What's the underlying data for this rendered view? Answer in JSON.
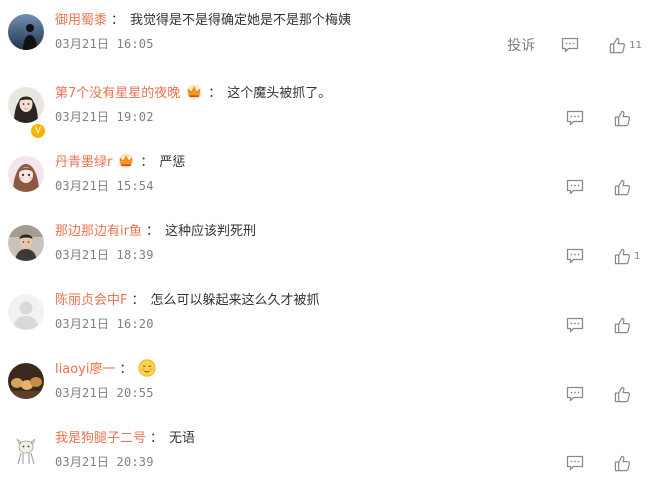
{
  "report_label": "投诉",
  "comments": [
    {
      "user": "御用蜀黍",
      "sep": "：",
      "text": "我觉得是不是得确定她是不是那个梅姨",
      "time": "03月21日 16:05",
      "likes": "11",
      "avatar_icon": "avatar-dark-silhouette",
      "vip_badge": false,
      "crown": false
    },
    {
      "user": "第7个没有星星的夜晚",
      "sep": "：",
      "text": "这个魔头被抓了。",
      "time": "03月21日 19:02",
      "likes": "",
      "avatar_icon": "avatar-girl-portrait",
      "vip_badge": true,
      "crown": true
    },
    {
      "user": "丹青墨绿r",
      "sep": "：",
      "text": "严惩",
      "time": "03月21日 15:54",
      "likes": "",
      "avatar_icon": "avatar-girl-cartoon",
      "vip_badge": false,
      "crown": true
    },
    {
      "user": "那边那边有ir鱼",
      "sep": "：",
      "text": "这种应该判死刑",
      "time": "03月21日 18:39",
      "likes": "1",
      "avatar_icon": "avatar-boy-photo",
      "vip_badge": false,
      "crown": false
    },
    {
      "user": "陈丽贞会中F",
      "sep": "：",
      "text": "怎么可以躲起来这么久才被抓",
      "time": "03月21日 16:20",
      "likes": "",
      "avatar_icon": "avatar-default-gray",
      "vip_badge": false,
      "crown": false
    },
    {
      "user": "liaoyi廖一",
      "sep": "：",
      "text": "",
      "emoji": "shy-face-emoji",
      "time": "03月21日 20:55",
      "likes": "",
      "avatar_icon": "avatar-food-photo",
      "vip_badge": false,
      "crown": false
    },
    {
      "user": "我是狗腿子二号",
      "sep": "：",
      "text": "无语",
      "time": "03月21日 20:39",
      "likes": "",
      "avatar_icon": "avatar-dog-cartoon",
      "vip_badge": false,
      "crown": false
    }
  ]
}
